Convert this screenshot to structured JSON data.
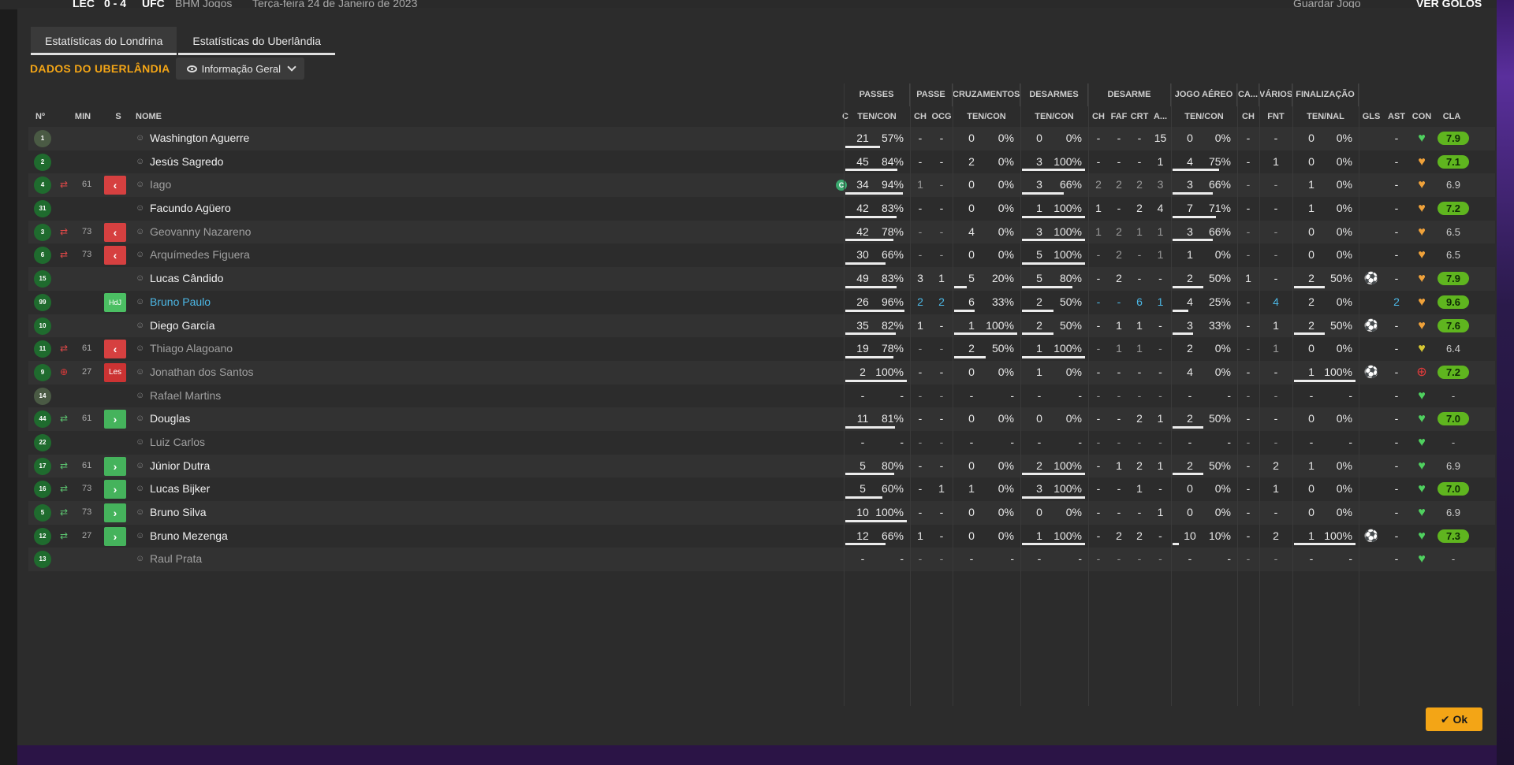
{
  "background": {
    "score_left": "LEC",
    "score": "0 - 4",
    "score_right": "UFC",
    "venue": "BHM Jogos",
    "date": "Terça-feira 24 de Janeiro de 2023",
    "save_label": "Guardar Jogo",
    "goals_label": "VER GOLOS"
  },
  "tabs": [
    {
      "label": "Estatísticas do Londrina",
      "active": true
    },
    {
      "label": "Estatísticas do Uberlândia",
      "active": false
    }
  ],
  "team_title": "DADOS DO UBERLÂNDIA",
  "view_dropdown": {
    "label": "Informação Geral"
  },
  "group_headers": [
    "PASSES",
    "PASSE",
    "CRUZAMENTOS",
    "DESARMES",
    "DESARME",
    "JOGO AÉREO",
    "CA...",
    "VÁRIOS",
    "FINALIZAÇÃO"
  ],
  "col_headers": {
    "no": "Nº",
    "min": "MIN",
    "s": "S",
    "name": "NOME",
    "c": "C",
    "passes": "TEN/CON",
    "passe_ch": "CH",
    "passe_ocg": "OCG",
    "cruz": "TEN/CON",
    "des": "TEN/CON",
    "desarme_ch": "CH",
    "desarme_faf": "FAF",
    "desarme_crt": "CRT",
    "desarme_a": "A...",
    "aereo": "TEN/CON",
    "ca_ch": "CH",
    "varios_fnt": "FNT",
    "final": "TEN/NAL",
    "gls": "GLS",
    "ast": "AST",
    "con": "CON",
    "cla": "CLA"
  },
  "players": [
    {
      "no": "1",
      "gk": true,
      "subicon": "",
      "min": "",
      "s": "",
      "name": "Washington Aguerre",
      "nstyle": "",
      "cap": false,
      "p_ten": "21",
      "p_pct": "57%",
      "p_bar": 0.57,
      "ch": "-",
      "ocg": "-",
      "cr_ten": "0",
      "cr_pct": "0%",
      "cr_bar": 0,
      "de_ten": "0",
      "de_pct": "0%",
      "de_bar": 0,
      "d_ch": "-",
      "d_faf": "-",
      "d_crt": "-",
      "d_a": "15",
      "ae_ten": "0",
      "ae_pct": "0%",
      "ae_bar": 0,
      "ca": "-",
      "fnt": "-",
      "f_ten": "0",
      "f_pct": "0%",
      "f_bar": 0,
      "gls": "",
      "ast": "-",
      "con": "green",
      "cla": "7.9",
      "cla_green": true
    },
    {
      "no": "2",
      "gk": false,
      "subicon": "",
      "min": "",
      "s": "",
      "name": "Jesús Sagredo",
      "nstyle": "",
      "cap": false,
      "p_ten": "45",
      "p_pct": "84%",
      "p_bar": 0.84,
      "ch": "-",
      "ocg": "-",
      "cr_ten": "2",
      "cr_pct": "0%",
      "cr_bar": 0,
      "de_ten": "3",
      "de_pct": "100%",
      "de_bar": 1,
      "d_ch": "-",
      "d_faf": "-",
      "d_crt": "-",
      "d_a": "1",
      "ae_ten": "4",
      "ae_pct": "75%",
      "ae_bar": 0.75,
      "ca": "-",
      "fnt": "1",
      "f_ten": "0",
      "f_pct": "0%",
      "f_bar": 0,
      "gls": "",
      "ast": "-",
      "con": "orange",
      "cla": "7.1",
      "cla_green": true
    },
    {
      "no": "4",
      "gk": false,
      "subicon": "out",
      "min": "61",
      "s": "out",
      "name": "Iago",
      "nstyle": "dim",
      "cap": true,
      "p_ten": "34",
      "p_pct": "94%",
      "p_bar": 0.94,
      "ch": "1",
      "ocg": "-",
      "cr_ten": "0",
      "cr_pct": "0%",
      "cr_bar": 0,
      "de_ten": "3",
      "de_pct": "66%",
      "de_bar": 0.66,
      "d_ch": "2",
      "d_faf": "2",
      "d_crt": "2",
      "d_a": "3",
      "ae_ten": "3",
      "ae_pct": "66%",
      "ae_bar": 0.66,
      "ca": "-",
      "fnt": "-",
      "f_ten": "1",
      "f_pct": "0%",
      "f_bar": 0,
      "gls": "",
      "ast": "-",
      "con": "orange",
      "cla": "6.9",
      "cla_green": false
    },
    {
      "no": "31",
      "gk": false,
      "subicon": "",
      "min": "",
      "s": "",
      "name": "Facundo Agüero",
      "nstyle": "",
      "cap": false,
      "p_ten": "42",
      "p_pct": "83%",
      "p_bar": 0.83,
      "ch": "-",
      "ocg": "-",
      "cr_ten": "0",
      "cr_pct": "0%",
      "cr_bar": 0,
      "de_ten": "1",
      "de_pct": "100%",
      "de_bar": 1,
      "d_ch": "1",
      "d_faf": "-",
      "d_crt": "2",
      "d_a": "4",
      "ae_ten": "7",
      "ae_pct": "71%",
      "ae_bar": 0.71,
      "ca": "-",
      "fnt": "-",
      "f_ten": "1",
      "f_pct": "0%",
      "f_bar": 0,
      "gls": "",
      "ast": "-",
      "con": "orange",
      "cla": "7.2",
      "cla_green": true
    },
    {
      "no": "3",
      "gk": false,
      "subicon": "out",
      "min": "73",
      "s": "out",
      "name": "Geovanny Nazareno",
      "nstyle": "dim",
      "cap": false,
      "p_ten": "42",
      "p_pct": "78%",
      "p_bar": 0.78,
      "ch": "-",
      "ocg": "-",
      "cr_ten": "4",
      "cr_pct": "0%",
      "cr_bar": 0,
      "de_ten": "3",
      "de_pct": "100%",
      "de_bar": 1,
      "d_ch": "1",
      "d_faf": "2",
      "d_crt": "1",
      "d_a": "1",
      "ae_ten": "3",
      "ae_pct": "66%",
      "ae_bar": 0.66,
      "ca": "-",
      "fnt": "-",
      "f_ten": "0",
      "f_pct": "0%",
      "f_bar": 0,
      "gls": "",
      "ast": "-",
      "con": "orange",
      "cla": "6.5",
      "cla_green": false
    },
    {
      "no": "6",
      "gk": false,
      "subicon": "out",
      "min": "73",
      "s": "out",
      "name": "Arquímedes Figuera",
      "nstyle": "dim",
      "cap": false,
      "p_ten": "30",
      "p_pct": "66%",
      "p_bar": 0.66,
      "ch": "-",
      "ocg": "-",
      "cr_ten": "0",
      "cr_pct": "0%",
      "cr_bar": 0,
      "de_ten": "5",
      "de_pct": "100%",
      "de_bar": 1,
      "d_ch": "-",
      "d_faf": "2",
      "d_crt": "-",
      "d_a": "1",
      "ae_ten": "1",
      "ae_pct": "0%",
      "ae_bar": 0,
      "ca": "-",
      "fnt": "-",
      "f_ten": "0",
      "f_pct": "0%",
      "f_bar": 0,
      "gls": "",
      "ast": "-",
      "con": "orange",
      "cla": "6.5",
      "cla_green": false
    },
    {
      "no": "15",
      "gk": false,
      "subicon": "",
      "min": "",
      "s": "",
      "name": "Lucas Cândido",
      "nstyle": "",
      "cap": false,
      "p_ten": "49",
      "p_pct": "83%",
      "p_bar": 0.83,
      "ch": "3",
      "ocg": "1",
      "cr_ten": "5",
      "cr_pct": "20%",
      "cr_bar": 0.2,
      "de_ten": "5",
      "de_pct": "80%",
      "de_bar": 0.8,
      "d_ch": "-",
      "d_faf": "2",
      "d_crt": "-",
      "d_a": "-",
      "ae_ten": "2",
      "ae_pct": "50%",
      "ae_bar": 0.5,
      "ca": "1",
      "fnt": "-",
      "f_ten": "2",
      "f_pct": "50%",
      "f_bar": 0.5,
      "gls": "ball",
      "ast": "-",
      "con": "orange",
      "cla": "7.9",
      "cla_green": true
    },
    {
      "no": "99",
      "gk": false,
      "subicon": "",
      "min": "",
      "s": "hdj",
      "name": "Bruno Paulo",
      "nstyle": "blue",
      "cap": false,
      "p_ten": "26",
      "p_pct": "96%",
      "p_bar": 0.96,
      "ch": "2",
      "ocg": "2",
      "cr_ten": "6",
      "cr_pct": "33%",
      "cr_bar": 0.33,
      "de_ten": "2",
      "de_pct": "50%",
      "de_bar": 0.5,
      "d_ch": "-",
      "d_faf": "-",
      "d_crt": "6",
      "d_a": "1",
      "ae_ten": "4",
      "ae_pct": "25%",
      "ae_bar": 0.25,
      "ca": "-",
      "fnt": "4",
      "f_ten": "2",
      "f_pct": "0%",
      "f_bar": 0,
      "gls": "",
      "ast": "2",
      "con": "orange",
      "cla": "9.6",
      "cla_green": true,
      "blue": true
    },
    {
      "no": "10",
      "gk": false,
      "subicon": "",
      "min": "",
      "s": "",
      "name": "Diego García",
      "nstyle": "",
      "cap": false,
      "p_ten": "35",
      "p_pct": "82%",
      "p_bar": 0.82,
      "ch": "1",
      "ocg": "-",
      "cr_ten": "1",
      "cr_pct": "100%",
      "cr_bar": 1,
      "de_ten": "2",
      "de_pct": "50%",
      "de_bar": 0.5,
      "d_ch": "-",
      "d_faf": "1",
      "d_crt": "1",
      "d_a": "-",
      "ae_ten": "3",
      "ae_pct": "33%",
      "ae_bar": 0.33,
      "ca": "-",
      "fnt": "1",
      "f_ten": "2",
      "f_pct": "50%",
      "f_bar": 0.5,
      "gls": "ball",
      "ast": "-",
      "con": "orange",
      "cla": "7.6",
      "cla_green": true
    },
    {
      "no": "11",
      "gk": false,
      "subicon": "out",
      "min": "61",
      "s": "out",
      "name": "Thiago Alagoano",
      "nstyle": "dim",
      "cap": false,
      "p_ten": "19",
      "p_pct": "78%",
      "p_bar": 0.78,
      "ch": "-",
      "ocg": "-",
      "cr_ten": "2",
      "cr_pct": "50%",
      "cr_bar": 0.5,
      "de_ten": "1",
      "de_pct": "100%",
      "de_bar": 1,
      "d_ch": "-",
      "d_faf": "1",
      "d_crt": "1",
      "d_a": "-",
      "ae_ten": "2",
      "ae_pct": "0%",
      "ae_bar": 0,
      "ca": "-",
      "fnt": "1",
      "f_ten": "0",
      "f_pct": "0%",
      "f_bar": 0,
      "gls": "",
      "ast": "-",
      "con": "yellow",
      "cla": "6.4",
      "cla_green": false
    },
    {
      "no": "9",
      "gk": false,
      "subicon": "injury",
      "min": "27",
      "s": "les",
      "name": "Jonathan dos Santos",
      "nstyle": "dim",
      "cap": false,
      "p_ten": "2",
      "p_pct": "100%",
      "p_bar": 1,
      "ch": "-",
      "ocg": "-",
      "cr_ten": "0",
      "cr_pct": "0%",
      "cr_bar": 0,
      "de_ten": "1",
      "de_pct": "0%",
      "de_bar": 0,
      "d_ch": "-",
      "d_faf": "-",
      "d_crt": "-",
      "d_a": "-",
      "ae_ten": "4",
      "ae_pct": "0%",
      "ae_bar": 0,
      "ca": "-",
      "fnt": "-",
      "f_ten": "1",
      "f_pct": "100%",
      "f_bar": 1,
      "gls": "ball",
      "ast": "-",
      "con": "red",
      "cla": "7.2",
      "cla_green": true
    },
    {
      "no": "14",
      "gk": true,
      "subicon": "",
      "min": "",
      "s": "",
      "name": "Rafael Martins",
      "nstyle": "dim",
      "cap": false,
      "p_ten": "-",
      "p_pct": "-",
      "p_bar": 0,
      "ch": "-",
      "ocg": "-",
      "cr_ten": "-",
      "cr_pct": "-",
      "cr_bar": 0,
      "de_ten": "-",
      "de_pct": "-",
      "de_bar": 0,
      "d_ch": "-",
      "d_faf": "-",
      "d_crt": "-",
      "d_a": "-",
      "ae_ten": "-",
      "ae_pct": "-",
      "ae_bar": 0,
      "ca": "-",
      "fnt": "-",
      "f_ten": "-",
      "f_pct": "-",
      "f_bar": 0,
      "gls": "",
      "ast": "-",
      "con": "green",
      "cla": "-",
      "cla_green": false
    },
    {
      "no": "44",
      "gk": false,
      "subicon": "in",
      "min": "61",
      "s": "in",
      "name": "Douglas",
      "nstyle": "",
      "cap": false,
      "p_ten": "11",
      "p_pct": "81%",
      "p_bar": 0.81,
      "ch": "-",
      "ocg": "-",
      "cr_ten": "0",
      "cr_pct": "0%",
      "cr_bar": 0,
      "de_ten": "0",
      "de_pct": "0%",
      "de_bar": 0,
      "d_ch": "-",
      "d_faf": "-",
      "d_crt": "2",
      "d_a": "1",
      "ae_ten": "2",
      "ae_pct": "50%",
      "ae_bar": 0.5,
      "ca": "-",
      "fnt": "-",
      "f_ten": "0",
      "f_pct": "0%",
      "f_bar": 0,
      "gls": "",
      "ast": "-",
      "con": "green",
      "cla": "7.0",
      "cla_green": true
    },
    {
      "no": "22",
      "gk": false,
      "subicon": "",
      "min": "",
      "s": "",
      "name": "Luiz Carlos",
      "nstyle": "dim",
      "cap": false,
      "p_ten": "-",
      "p_pct": "-",
      "p_bar": 0,
      "ch": "-",
      "ocg": "-",
      "cr_ten": "-",
      "cr_pct": "-",
      "cr_bar": 0,
      "de_ten": "-",
      "de_pct": "-",
      "de_bar": 0,
      "d_ch": "-",
      "d_faf": "-",
      "d_crt": "-",
      "d_a": "-",
      "ae_ten": "-",
      "ae_pct": "-",
      "ae_bar": 0,
      "ca": "-",
      "fnt": "-",
      "f_ten": "-",
      "f_pct": "-",
      "f_bar": 0,
      "gls": "",
      "ast": "-",
      "con": "green",
      "cla": "-",
      "cla_green": false
    },
    {
      "no": "17",
      "gk": false,
      "subicon": "in",
      "min": "61",
      "s": "in",
      "name": "Júnior Dutra",
      "nstyle": "",
      "cap": false,
      "p_ten": "5",
      "p_pct": "80%",
      "p_bar": 0.8,
      "ch": "-",
      "ocg": "-",
      "cr_ten": "0",
      "cr_pct": "0%",
      "cr_bar": 0,
      "de_ten": "2",
      "de_pct": "100%",
      "de_bar": 1,
      "d_ch": "-",
      "d_faf": "1",
      "d_crt": "2",
      "d_a": "1",
      "ae_ten": "2",
      "ae_pct": "50%",
      "ae_bar": 0.5,
      "ca": "-",
      "fnt": "2",
      "f_ten": "1",
      "f_pct": "0%",
      "f_bar": 0,
      "gls": "",
      "ast": "-",
      "con": "green",
      "cla": "6.9",
      "cla_green": false
    },
    {
      "no": "16",
      "gk": false,
      "subicon": "in",
      "min": "73",
      "s": "in",
      "name": "Lucas Bijker",
      "nstyle": "",
      "cap": false,
      "p_ten": "5",
      "p_pct": "60%",
      "p_bar": 0.6,
      "ch": "-",
      "ocg": "1",
      "cr_ten": "1",
      "cr_pct": "0%",
      "cr_bar": 0,
      "de_ten": "3",
      "de_pct": "100%",
      "de_bar": 1,
      "d_ch": "-",
      "d_faf": "-",
      "d_crt": "1",
      "d_a": "-",
      "ae_ten": "0",
      "ae_pct": "0%",
      "ae_bar": 0,
      "ca": "-",
      "fnt": "1",
      "f_ten": "0",
      "f_pct": "0%",
      "f_bar": 0,
      "gls": "",
      "ast": "-",
      "con": "green",
      "cla": "7.0",
      "cla_green": true
    },
    {
      "no": "5",
      "gk": false,
      "subicon": "in",
      "min": "73",
      "s": "in",
      "name": "Bruno Silva",
      "nstyle": "",
      "cap": false,
      "p_ten": "10",
      "p_pct": "100%",
      "p_bar": 1,
      "ch": "-",
      "ocg": "-",
      "cr_ten": "0",
      "cr_pct": "0%",
      "cr_bar": 0,
      "de_ten": "0",
      "de_pct": "0%",
      "de_bar": 0,
      "d_ch": "-",
      "d_faf": "-",
      "d_crt": "-",
      "d_a": "1",
      "ae_ten": "0",
      "ae_pct": "0%",
      "ae_bar": 0,
      "ca": "-",
      "fnt": "-",
      "f_ten": "0",
      "f_pct": "0%",
      "f_bar": 0,
      "gls": "",
      "ast": "-",
      "con": "green",
      "cla": "6.9",
      "cla_green": false
    },
    {
      "no": "12",
      "gk": false,
      "subicon": "in",
      "min": "27",
      "s": "in",
      "name": "Bruno Mezenga",
      "nstyle": "",
      "cap": false,
      "p_ten": "12",
      "p_pct": "66%",
      "p_bar": 0.66,
      "ch": "1",
      "ocg": "-",
      "cr_ten": "0",
      "cr_pct": "0%",
      "cr_bar": 0,
      "de_ten": "1",
      "de_pct": "100%",
      "de_bar": 1,
      "d_ch": "-",
      "d_faf": "2",
      "d_crt": "2",
      "d_a": "-",
      "ae_ten": "10",
      "ae_pct": "10%",
      "ae_bar": 0.1,
      "ca": "-",
      "fnt": "2",
      "f_ten": "1",
      "f_pct": "100%",
      "f_bar": 1,
      "gls": "ball",
      "ast": "-",
      "con": "green",
      "cla": "7.3",
      "cla_green": true
    },
    {
      "no": "13",
      "gk": false,
      "subicon": "",
      "min": "",
      "s": "",
      "name": "Raul Prata",
      "nstyle": "dim",
      "cap": false,
      "p_ten": "-",
      "p_pct": "-",
      "p_bar": 0,
      "ch": "-",
      "ocg": "-",
      "cr_ten": "-",
      "cr_pct": "-",
      "cr_bar": 0,
      "de_ten": "-",
      "de_pct": "-",
      "de_bar": 0,
      "d_ch": "-",
      "d_faf": "-",
      "d_crt": "-",
      "d_a": "-",
      "ae_ten": "-",
      "ae_pct": "-",
      "ae_bar": 0,
      "ca": "-",
      "fnt": "-",
      "f_ten": "-",
      "f_pct": "-",
      "f_bar": 0,
      "gls": "",
      "ast": "-",
      "con": "green",
      "cla": "-",
      "cla_green": false
    }
  ],
  "hdj_label": "HdJ",
  "les_label": "Les",
  "captain_label": "C",
  "ok_label": "Ok",
  "colors": {
    "accent": "#f3a516",
    "rating_green": "#5fb51f",
    "sub_out": "#d64040",
    "sub_in": "#45b35c",
    "blue_name": "#4cb8e6"
  }
}
